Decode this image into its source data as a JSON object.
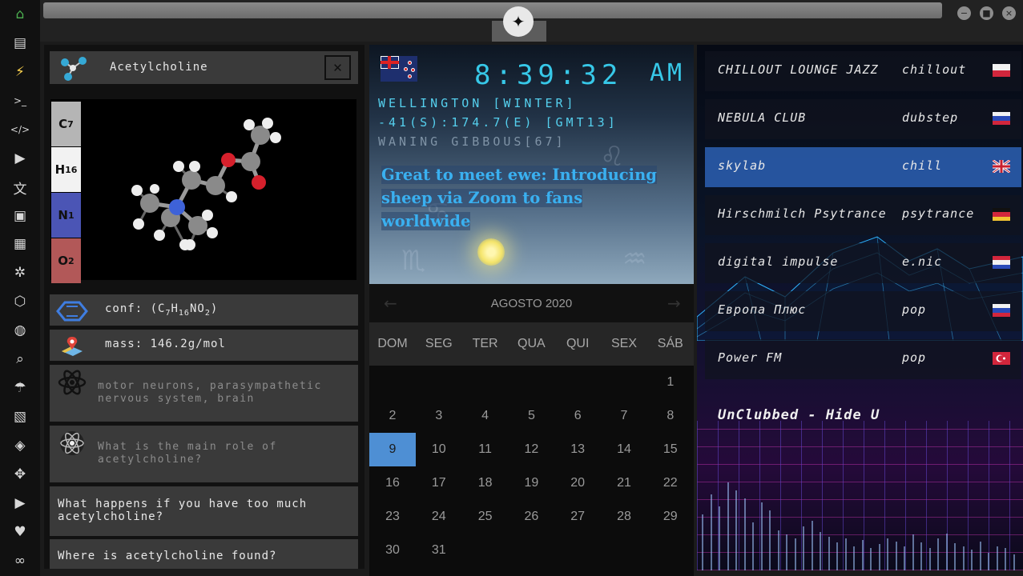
{
  "dock": {
    "items": [
      {
        "icon": "home-icon",
        "glyph": "⌂"
      },
      {
        "icon": "document-icon",
        "glyph": "▤"
      },
      {
        "icon": "bolt-icon",
        "glyph": "⚡"
      },
      {
        "icon": "terminal-icon",
        "glyph": ">_"
      },
      {
        "icon": "code-icon",
        "glyph": "</>"
      },
      {
        "icon": "play-icon",
        "glyph": "▶"
      },
      {
        "icon": "translate-icon",
        "glyph": "文"
      },
      {
        "icon": "image-icon",
        "glyph": "▣"
      },
      {
        "icon": "news-icon",
        "glyph": "▦"
      },
      {
        "icon": "settings-icon",
        "glyph": "✲"
      },
      {
        "icon": "hexagon-icon",
        "glyph": "⬡"
      },
      {
        "icon": "globe-icon",
        "glyph": "◍"
      },
      {
        "icon": "search-icon",
        "glyph": "⌕"
      },
      {
        "icon": "umbrella-icon",
        "glyph": "☂"
      },
      {
        "icon": "contacts-icon",
        "glyph": "▧"
      },
      {
        "icon": "share-icon",
        "glyph": "◈"
      },
      {
        "icon": "expand-icon",
        "glyph": "✥"
      },
      {
        "icon": "youtube-icon",
        "glyph": "▶"
      },
      {
        "icon": "heart-icon",
        "glyph": "♥"
      },
      {
        "icon": "infinity-icon",
        "glyph": "∞"
      }
    ]
  },
  "window": {
    "emblem_glyph": "✦",
    "minimize_glyph": "−",
    "maximize_glyph": "■",
    "close_glyph": "×"
  },
  "chem": {
    "name": "Acetylcholine",
    "close_glyph": "✕",
    "elements": [
      {
        "symbol": "C",
        "count": "7",
        "color": "#b5b5b5"
      },
      {
        "symbol": "H",
        "count": "16",
        "color": "#f2f2f2"
      },
      {
        "symbol": "N",
        "count": "1",
        "color": "#4b55b5"
      },
      {
        "symbol": "O",
        "count": "2",
        "color": "#b25858"
      }
    ],
    "conf": {
      "prefix": "conf: (C",
      "c": "7",
      "h_label": "H",
      "h": "16",
      "n_label": "NO",
      "o": "2",
      "suffix": ")"
    },
    "mass": "mass: 146.2g/mol",
    "location": "motor neurons, parasympathetic nervous system, brain",
    "questions": [
      "What is the main role of acetylcholine?",
      "What happens if you have too much acetylcholine?",
      "Where is acetylcholine found?"
    ]
  },
  "clock": {
    "time": "8:39:32",
    "ampm": "AM",
    "city_line": "WELLINGTON [WINTER]",
    "coords_line": "-41(S):174.7(E) [GMT13]",
    "moon_line": "WANING GIBBOUS[67]",
    "news_line1": "Great to meet ewe: Introducing",
    "news_line2": "sheep via Zoom to fans worldwide"
  },
  "calendar": {
    "month": "AGOSTO 2020",
    "prev_glyph": "←",
    "next_glyph": "→",
    "days": [
      "DOM",
      "SEG",
      "TER",
      "QUA",
      "QUI",
      "SEX",
      "SÁB"
    ],
    "first_weekday": 6,
    "num_days": 31,
    "today": 9
  },
  "radio": {
    "stations": [
      {
        "name": "CHILLOUT LOUNGE JAZZ",
        "genre": "chillout",
        "flag": "poland-flag",
        "colors": [
          "#f2f2f2",
          "#d2263c"
        ]
      },
      {
        "name": "NEBULA CLUB",
        "genre": "dubstep",
        "flag": "russia-flag",
        "colors": [
          "#f2f2f2",
          "#2a4bb8",
          "#d2263c"
        ]
      },
      {
        "name": "skylab",
        "genre": "chill",
        "flag": "uk-flag",
        "colors": [
          "#2a3f8f",
          "#f2f2f2",
          "#c8202f"
        ]
      },
      {
        "name": "Hirschmilch Psytrance",
        "genre": "psytrance",
        "flag": "germany-flag",
        "colors": [
          "#111111",
          "#d2263c",
          "#f1c232"
        ]
      },
      {
        "name": "digital impulse",
        "genre": "e.nic",
        "flag": "croatia-flag",
        "colors": [
          "#d2263c",
          "#f2f2f2",
          "#2a4bb8"
        ]
      },
      {
        "name": "Европа Плюс",
        "genre": "pop",
        "flag": "russia-flag",
        "colors": [
          "#f2f2f2",
          "#2a4bb8",
          "#d2263c"
        ]
      },
      {
        "name": "Power FM",
        "genre": "pop",
        "flag": "turkey-flag",
        "colors": [
          "#d2263c",
          "#d2263c"
        ]
      }
    ],
    "selected": 2,
    "now_playing": "UnClubbed - Hide U"
  }
}
